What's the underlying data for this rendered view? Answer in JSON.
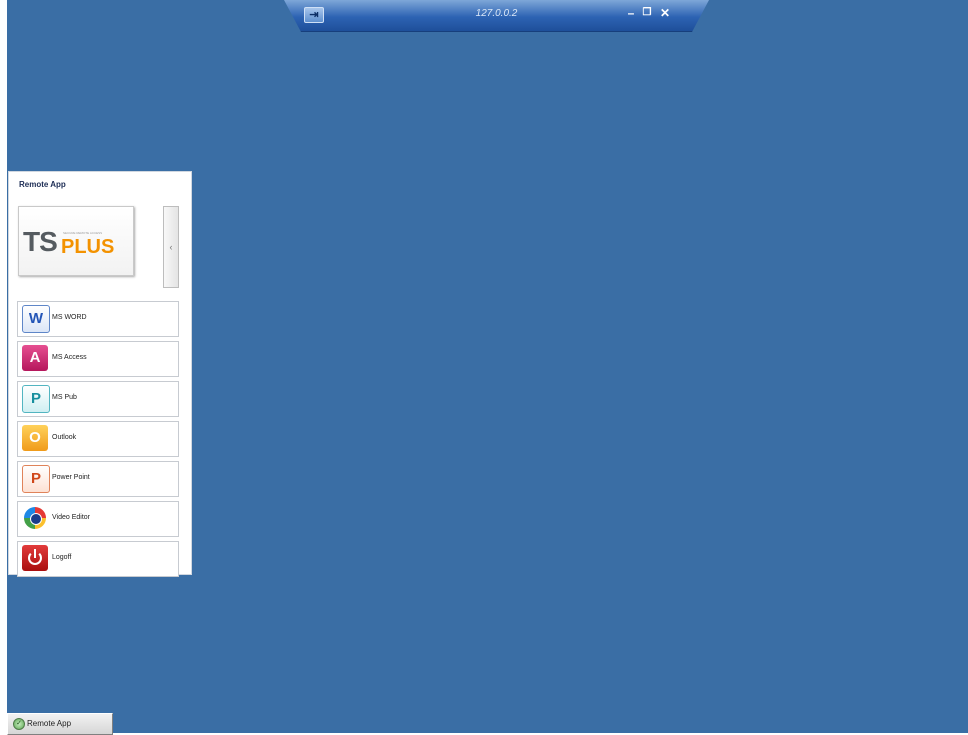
{
  "rdp_bar": {
    "title": "127.0.0.2",
    "pin_icon": "pin-icon",
    "minimize_glyph": "–",
    "restore_glyph": "❐",
    "close_glyph": "✕"
  },
  "panel": {
    "title": "Remote App",
    "logo": {
      "ts": "TS",
      "plus": "PLUS",
      "tagline": "SECURE REMOTE ACCESS"
    },
    "collapse_glyph": "‹",
    "apps": [
      {
        "label": "MS WORD",
        "icon": "word-icon",
        "glyph": "W"
      },
      {
        "label": "MS Access",
        "icon": "access-icon",
        "glyph": "A"
      },
      {
        "label": "MS Pub",
        "icon": "publisher-icon",
        "glyph": "P"
      },
      {
        "label": "Outlook",
        "icon": "outlook-icon",
        "glyph": "O"
      },
      {
        "label": "Power Point",
        "icon": "powerpoint-icon",
        "glyph": "P"
      },
      {
        "label": "Video Editor",
        "icon": "video-editor-icon",
        "glyph": ""
      },
      {
        "label": "Logoff",
        "icon": "power-icon",
        "glyph": ""
      }
    ]
  },
  "taskbar": {
    "button_label": "Remote App",
    "icon": "remote-app-icon"
  },
  "colors": {
    "desktop": "#3a6ea5",
    "rdp_bar": "#2d63b3",
    "logo_gray": "#555b60",
    "logo_orange": "#f39200"
  }
}
